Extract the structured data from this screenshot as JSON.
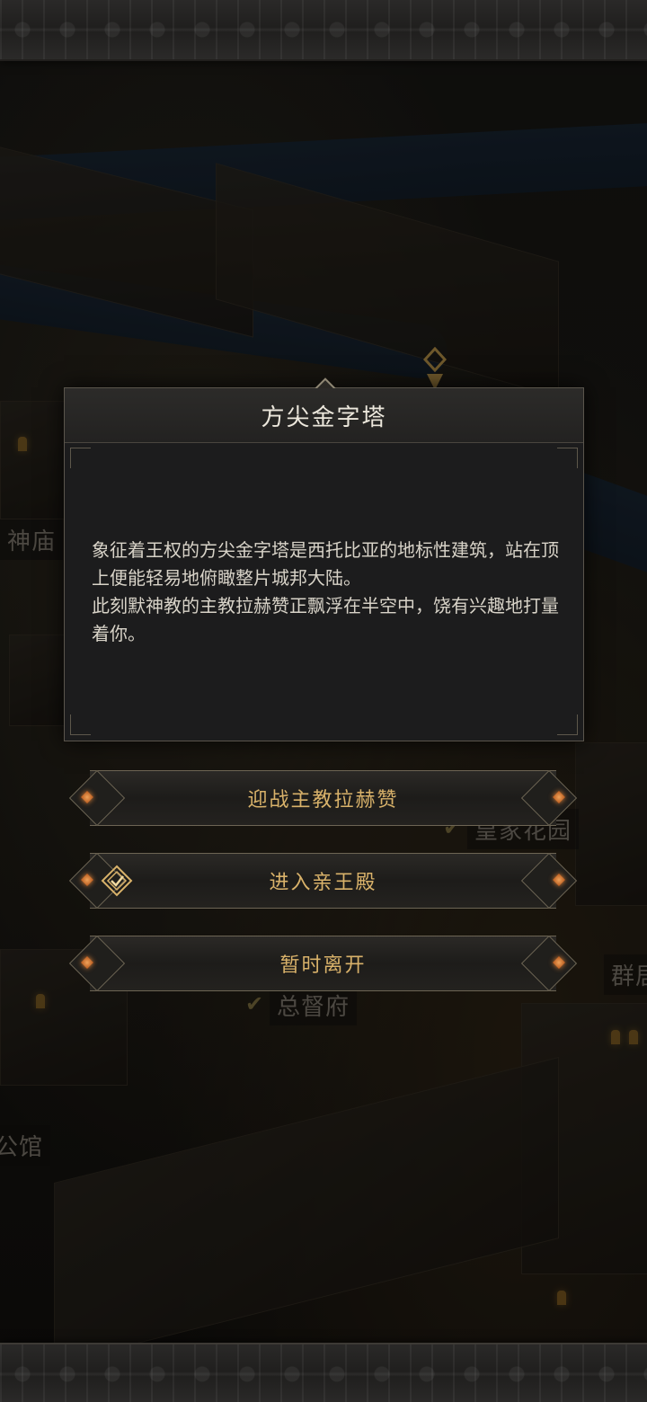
{
  "map": {
    "labels": {
      "temple": "神庙",
      "royal_garden": "皇家花园",
      "governor_house": "总督府",
      "left_bottom": "公馆",
      "right_cut": "群居"
    }
  },
  "dialog": {
    "title": "方尖金字塔",
    "paragraphs": [
      "象征着王权的方尖金字塔是西托比亚的地标性建筑，站在顶上便能轻易地俯瞰整片城邦大陆。",
      "此刻默神教的主教拉赫赞正飘浮在半空中，饶有兴趣地打量着你。"
    ]
  },
  "actions": {
    "fight": "迎战主教拉赫赞",
    "enter": "进入亲王殿",
    "leave": "暂时离开"
  },
  "colors": {
    "accent_gold": "#d9b26a",
    "gem_orange": "#f08a3c",
    "panel_bg": "#1c1c1d"
  }
}
